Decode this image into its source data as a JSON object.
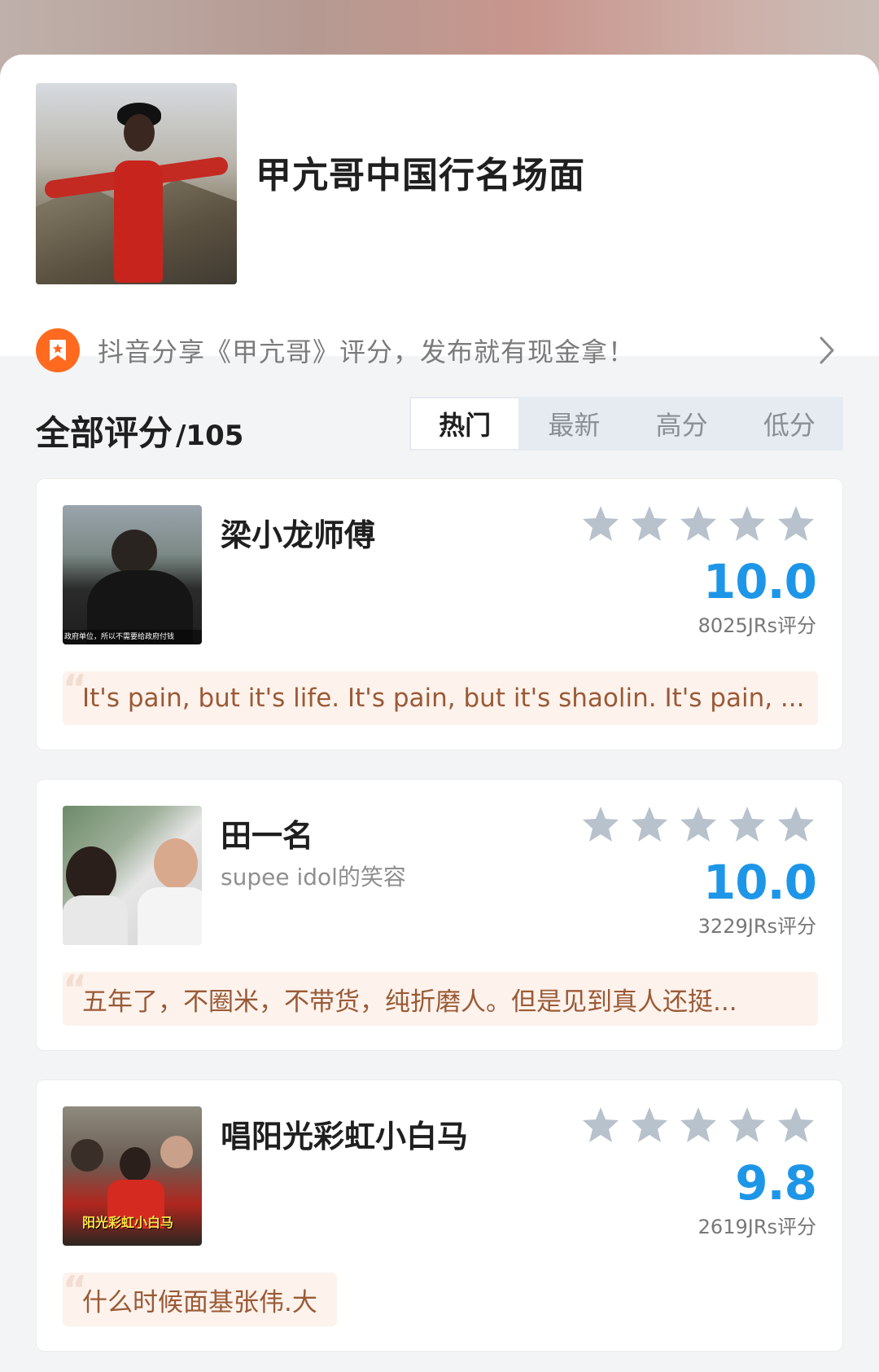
{
  "header": {
    "title": "甲亢哥中国行名场面"
  },
  "promo": {
    "text": "抖音分享《甲亢哥》评分，发布就有现金拿！",
    "icon": "bookmark-star-icon",
    "accent": "#ff6a1f"
  },
  "section": {
    "title": "全部评分",
    "count": "/105"
  },
  "tabs": [
    {
      "label": "热门",
      "active": true
    },
    {
      "label": "最新",
      "active": false
    },
    {
      "label": "高分",
      "active": false
    },
    {
      "label": "低分",
      "active": false
    }
  ],
  "reviews": [
    {
      "name": "梁小龙师傅",
      "subtitle": "",
      "stars": 5,
      "score": "10.0",
      "votes": "8025JRs评分",
      "quote": "It's pain, but it's life. It's pain, but it's shaolin. It's pain, ...",
      "thumb_caption": "政府单位，所以不需要给政府付钱"
    },
    {
      "name": "田一名",
      "subtitle": "supee idol的笑容",
      "stars": 5,
      "score": "10.0",
      "votes": "3229JRs评分",
      "quote": "五年了，不圈米，不带货，纯折磨人。但是见到真人还挺...",
      "thumb_caption": ""
    },
    {
      "name": "唱阳光彩虹小白马",
      "subtitle": "",
      "stars": 5,
      "score": "9.8",
      "votes": "2619JRs评分",
      "quote": "什么时候面基张伟.大",
      "thumb_caption": "阳光彩虹小白马"
    }
  ],
  "colors": {
    "score": "#1e96e8",
    "star": "#b8c2cc",
    "quote_bg": "#fdf2ec",
    "quote_text": "#9a5a36"
  }
}
